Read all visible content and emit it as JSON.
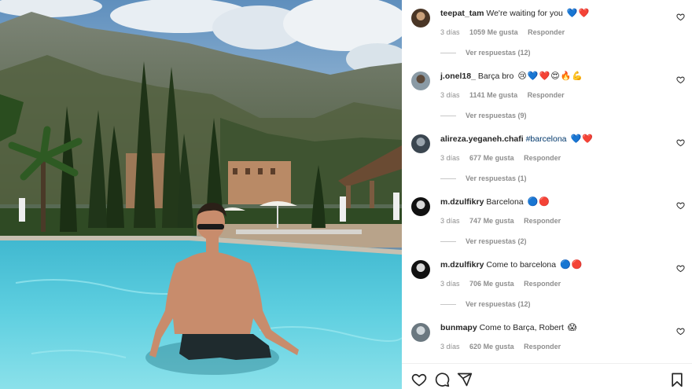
{
  "post": {
    "comments": [
      {
        "user": "teepat_tam",
        "text": "We're waiting for you",
        "hashtag": "",
        "emoji": "💙❤️",
        "time": "3 días",
        "likes": "1059 Me gusta",
        "reply": "Responder",
        "replies": "Ver respuestas (12)",
        "avatar_colors": [
          "#4a3626",
          "#c9a07a"
        ]
      },
      {
        "user": "j.onel18_",
        "text": "Barça bro",
        "hashtag": "",
        "emoji": "😢💙❤️😍🔥💪",
        "time": "3 días",
        "likes": "1141 Me gusta",
        "reply": "Responder",
        "replies": "Ver respuestas (9)",
        "avatar_colors": [
          "#8a9aa5",
          "#5d4a3b"
        ]
      },
      {
        "user": "alireza.yeganeh.chafi",
        "text": "",
        "hashtag": "#barcelona",
        "emoji": "💙❤️",
        "time": "3 días",
        "likes": "677 Me gusta",
        "reply": "Responder",
        "replies": "Ver respuestas (1)",
        "avatar_colors": [
          "#3b4650",
          "#9aa4ad"
        ]
      },
      {
        "user": "m.dzulfikry",
        "text": "Barcelona",
        "hashtag": "",
        "emoji": "🔵🔴",
        "time": "3 días",
        "likes": "747 Me gusta",
        "reply": "Responder",
        "replies": "Ver respuestas (2)",
        "avatar_colors": [
          "#111111",
          "#d8d8d8"
        ]
      },
      {
        "user": "m.dzulfikry",
        "text": "Come to barcelona",
        "hashtag": "",
        "emoji": "🔵🔴",
        "time": "3 días",
        "likes": "706 Me gusta",
        "reply": "Responder",
        "replies": "Ver respuestas (12)",
        "avatar_colors": [
          "#111111",
          "#d8d8d8"
        ]
      },
      {
        "user": "bunmapy",
        "text": "Come to Barça, Robert",
        "hashtag": "",
        "emoji": "😱",
        "time": "3 días",
        "likes": "620 Me gusta",
        "reply": "Responder",
        "replies": "",
        "avatar_colors": [
          "#6b7880",
          "#cfd6da"
        ]
      }
    ]
  },
  "icons": {
    "comment_like": "heart-outline-icon",
    "like": "heart-icon",
    "comment": "speech-bubble-icon",
    "share": "paper-plane-icon",
    "save": "bookmark-icon"
  },
  "colors": {
    "text": "#262626",
    "muted": "#8e8e8e",
    "link": "#00376b",
    "pool": "#4cc3d6"
  }
}
